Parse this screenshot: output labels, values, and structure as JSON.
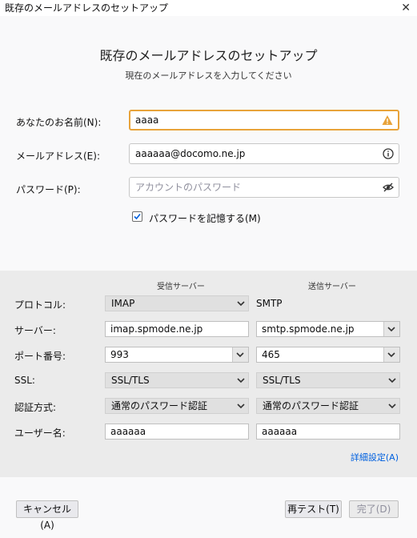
{
  "window": {
    "title": "既存のメールアドレスのセットアップ",
    "close_glyph": "✕"
  },
  "header": {
    "title": "既存のメールアドレスのセットアップ",
    "subtitle": "現在のメールアドレスを入力してください"
  },
  "form": {
    "name_label": "あなたのお名前(N):",
    "name_value": "aaaa",
    "email_label": "メールアドレス(E):",
    "email_value": "aaaaaa@docomo.ne.jp",
    "password_label": "パスワード(P):",
    "password_placeholder": "アカウントのパスワード",
    "remember_label": "パスワードを記憶する(M)",
    "remember_checked": true
  },
  "server": {
    "incoming_header": "受信サーバー",
    "outgoing_header": "送信サーバー",
    "protocol_label": "プロトコル:",
    "protocol_in": "IMAP",
    "protocol_out": "SMTP",
    "server_label": "サーバー:",
    "server_in": "imap.spmode.ne.jp",
    "server_out": "smtp.spmode.ne.jp",
    "port_label": "ポート番号:",
    "port_in": "993",
    "port_out": "465",
    "ssl_label": "SSL:",
    "ssl_in": "SSL/TLS",
    "ssl_out": "SSL/TLS",
    "auth_label": "認証方式:",
    "auth_in": "通常のパスワード認証",
    "auth_out": "通常のパスワード認証",
    "username_label": "ユーザー名:",
    "username_in": "aaaaaa",
    "username_out": "aaaaaa",
    "advanced_link": "詳細設定(A)"
  },
  "footer": {
    "cancel": "キャンセル(A)",
    "retest": "再テスト(T)",
    "done": "完了(D)"
  },
  "colors": {
    "warning": "#e8a33a",
    "link": "#0060df",
    "check": "#0060df"
  }
}
